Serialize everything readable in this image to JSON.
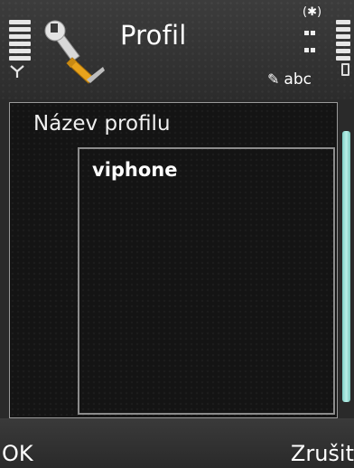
{
  "header": {
    "title": "Profil",
    "input_mode": "abc",
    "bluetooth_glyph": "(✱)",
    "icons": [
      "signal-strength-icon",
      "antenna-icon",
      "wrench-screwdriver-icon",
      "bluetooth-icon",
      "keypad-icon",
      "pen-icon",
      "battery-icon"
    ]
  },
  "form": {
    "field_label": "Název profilu",
    "field_value": "viphone"
  },
  "softkeys": {
    "left": "OK",
    "right": "Zrušit"
  },
  "colors": {
    "scrollbar": "#9fe0d8",
    "background": "#141414",
    "text": "#ffffff"
  }
}
